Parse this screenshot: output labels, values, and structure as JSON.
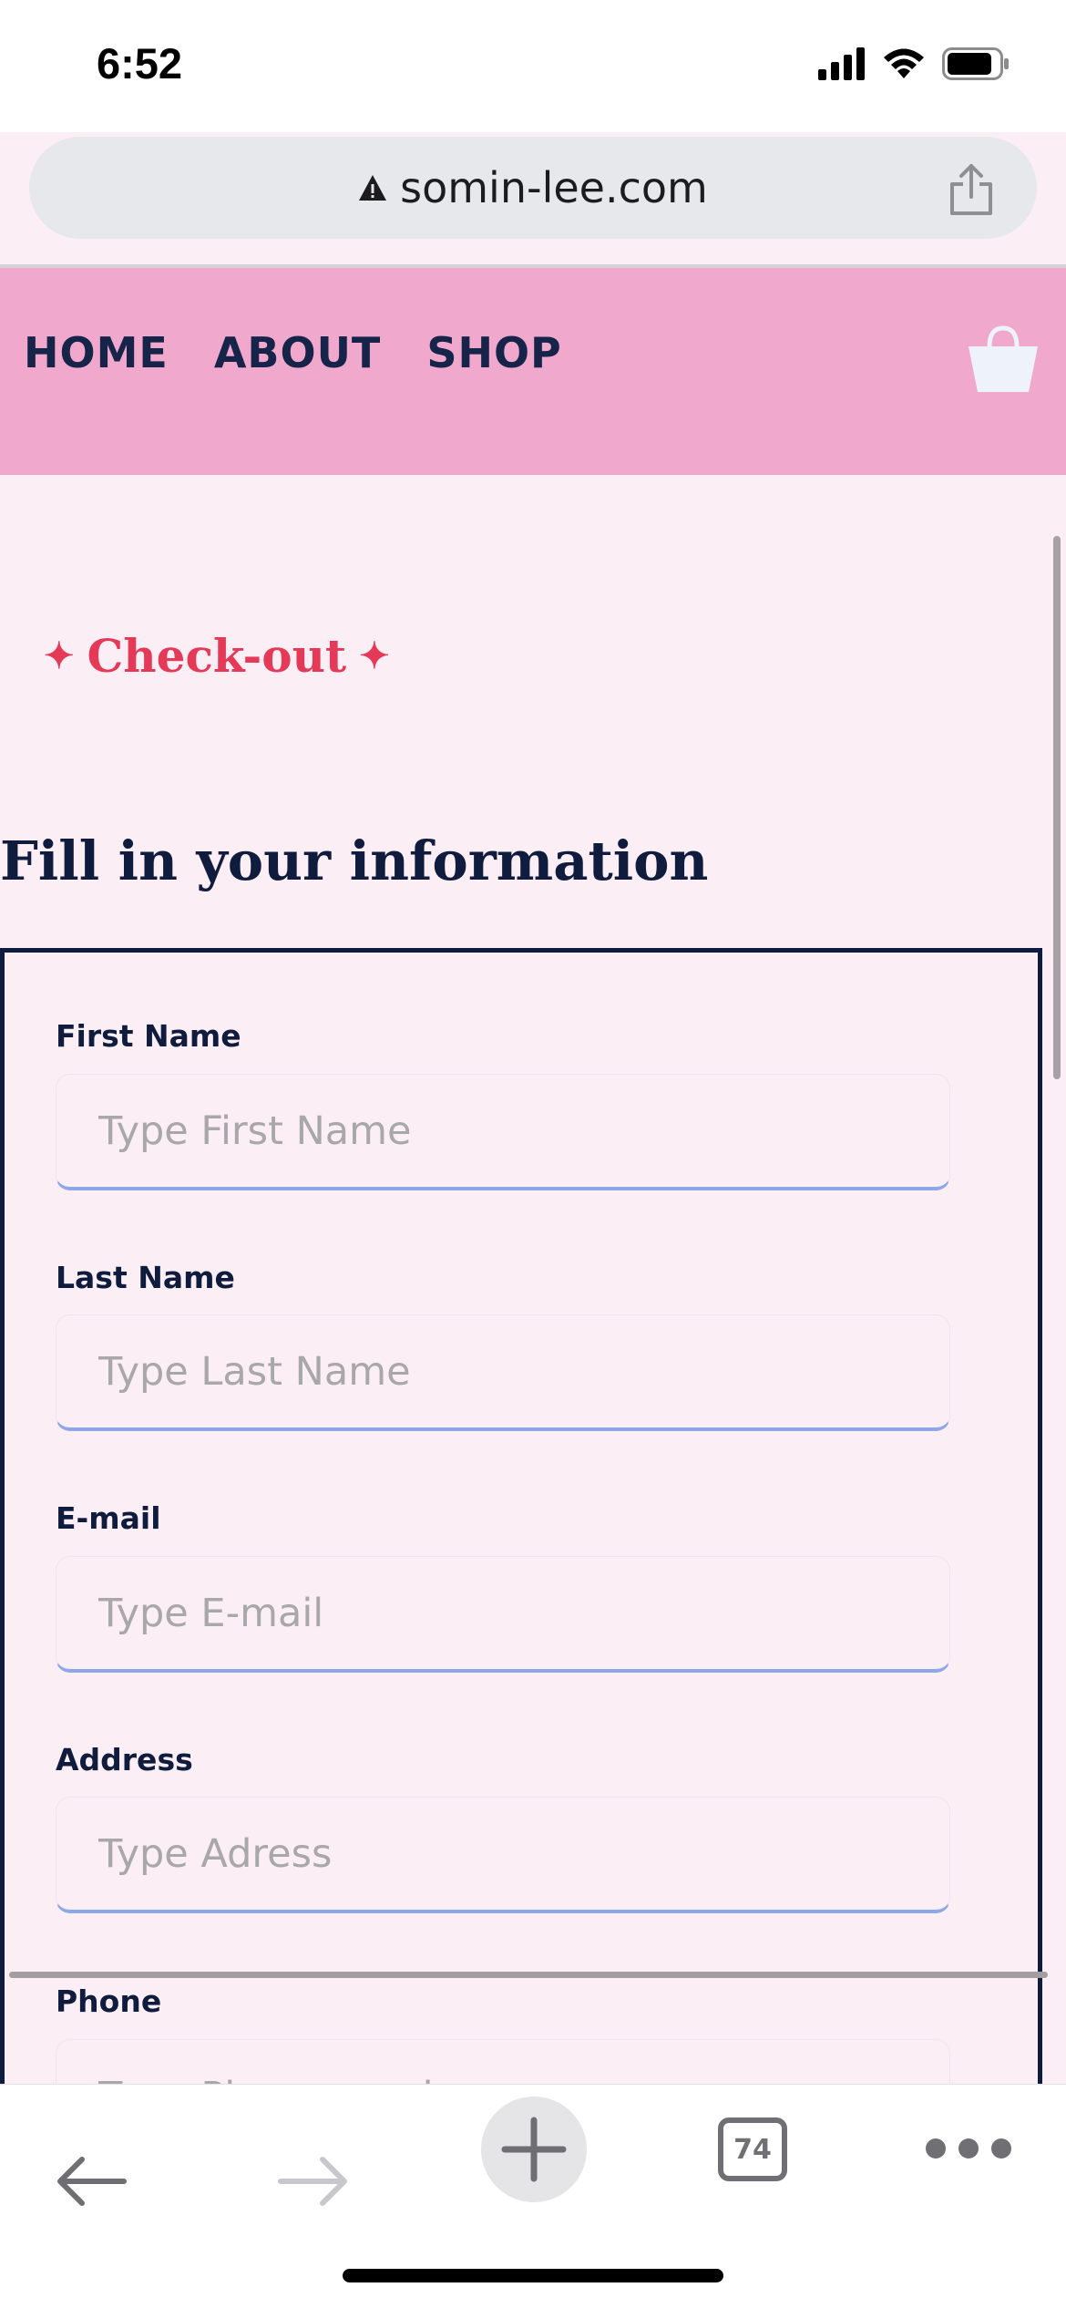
{
  "status_bar": {
    "time": "6:52"
  },
  "browser": {
    "url": "somin-lee.com",
    "open_tabs": "74"
  },
  "nav": {
    "links": [
      "HOME",
      "ABOUT",
      "SHOP"
    ]
  },
  "page": {
    "section_tag": "Check-out",
    "sparkle": "✦",
    "heading": "Fill in your information"
  },
  "form": {
    "fields": [
      {
        "label": "First Name",
        "placeholder": "Type First Name"
      },
      {
        "label": "Last Name",
        "placeholder": "Type Last Name"
      },
      {
        "label": "E-mail",
        "placeholder": "Type E-mail"
      },
      {
        "label": "Address",
        "placeholder": "Type Adress"
      },
      {
        "label": "Phone",
        "placeholder": "Type Phone number"
      }
    ]
  },
  "icons": {
    "status": [
      "signal-icon",
      "wifi-icon",
      "battery-icon"
    ],
    "address": [
      "warning-icon",
      "share-icon"
    ],
    "nav": [
      "shopping-bag-icon"
    ],
    "toolbar": [
      "back-arrow-icon",
      "forward-arrow-icon",
      "plus-icon",
      "tabs-icon",
      "more-icon"
    ]
  },
  "colors": {
    "nav_background": "#f1a8cd",
    "page_background": "#fbeef4",
    "accent": "#e53958",
    "text_dark": "#0f1c3d",
    "input_underline": "#8ea7e8"
  }
}
